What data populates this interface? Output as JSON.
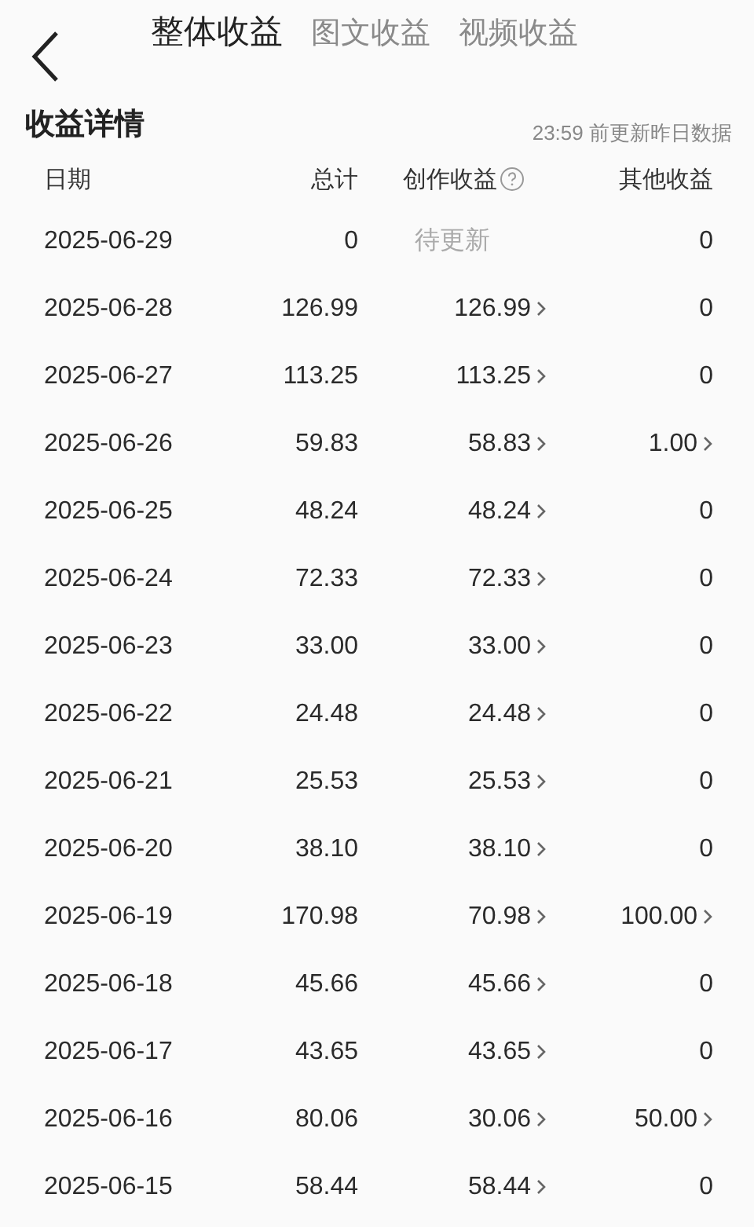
{
  "top_bar": {
    "tabs": [
      {
        "label": "整体收益",
        "selected": true
      },
      {
        "label": "图文收益",
        "selected": false
      },
      {
        "label": "视频收益",
        "selected": false
      }
    ]
  },
  "section": {
    "title": "收益详情",
    "update_note": "23:59 前更新昨日数据"
  },
  "table": {
    "columns": [
      "日期",
      "总计",
      "创作收益",
      "其他收益"
    ],
    "rows": [
      {
        "date": "2025-06-29",
        "total": "0",
        "creation": {
          "text": "待更新",
          "kind": "pending"
        },
        "other": {
          "text": "0",
          "kind": "plain"
        }
      },
      {
        "date": "2025-06-28",
        "total": "126.99",
        "creation": {
          "text": "126.99",
          "kind": "link"
        },
        "other": {
          "text": "0",
          "kind": "plain"
        }
      },
      {
        "date": "2025-06-27",
        "total": "113.25",
        "creation": {
          "text": "113.25",
          "kind": "link"
        },
        "other": {
          "text": "0",
          "kind": "plain"
        }
      },
      {
        "date": "2025-06-26",
        "total": "59.83",
        "creation": {
          "text": "58.83",
          "kind": "link"
        },
        "other": {
          "text": "1.00",
          "kind": "link"
        }
      },
      {
        "date": "2025-06-25",
        "total": "48.24",
        "creation": {
          "text": "48.24",
          "kind": "link"
        },
        "other": {
          "text": "0",
          "kind": "plain"
        }
      },
      {
        "date": "2025-06-24",
        "total": "72.33",
        "creation": {
          "text": "72.33",
          "kind": "link"
        },
        "other": {
          "text": "0",
          "kind": "plain"
        }
      },
      {
        "date": "2025-06-23",
        "total": "33.00",
        "creation": {
          "text": "33.00",
          "kind": "link"
        },
        "other": {
          "text": "0",
          "kind": "plain"
        }
      },
      {
        "date": "2025-06-22",
        "total": "24.48",
        "creation": {
          "text": "24.48",
          "kind": "link"
        },
        "other": {
          "text": "0",
          "kind": "plain"
        }
      },
      {
        "date": "2025-06-21",
        "total": "25.53",
        "creation": {
          "text": "25.53",
          "kind": "link"
        },
        "other": {
          "text": "0",
          "kind": "plain"
        }
      },
      {
        "date": "2025-06-20",
        "total": "38.10",
        "creation": {
          "text": "38.10",
          "kind": "link"
        },
        "other": {
          "text": "0",
          "kind": "plain"
        }
      },
      {
        "date": "2025-06-19",
        "total": "170.98",
        "creation": {
          "text": "70.98",
          "kind": "link"
        },
        "other": {
          "text": "100.00",
          "kind": "link"
        }
      },
      {
        "date": "2025-06-18",
        "total": "45.66",
        "creation": {
          "text": "45.66",
          "kind": "link"
        },
        "other": {
          "text": "0",
          "kind": "plain"
        }
      },
      {
        "date": "2025-06-17",
        "total": "43.65",
        "creation": {
          "text": "43.65",
          "kind": "link"
        },
        "other": {
          "text": "0",
          "kind": "plain"
        }
      },
      {
        "date": "2025-06-16",
        "total": "80.06",
        "creation": {
          "text": "30.06",
          "kind": "link"
        },
        "other": {
          "text": "50.00",
          "kind": "link"
        }
      },
      {
        "date": "2025-06-15",
        "total": "58.44",
        "creation": {
          "text": "58.44",
          "kind": "link"
        },
        "other": {
          "text": "0",
          "kind": "plain"
        }
      }
    ]
  }
}
